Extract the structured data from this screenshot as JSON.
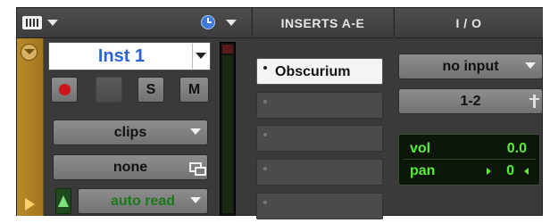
{
  "header": {
    "inserts_title": "INSERTS A-E",
    "io_title": "I / O"
  },
  "track": {
    "name": "Inst 1",
    "solo_label": "S",
    "mute_label": "M",
    "playlist": "clips",
    "group": "none",
    "automation_mode": "auto read"
  },
  "inserts": {
    "slot_a": "Obscurium",
    "slot_b": "",
    "slot_c": "",
    "slot_d": "",
    "slot_e": ""
  },
  "io": {
    "input": "no input",
    "output": "1-2",
    "vol_label": "vol",
    "vol_value": "0.0",
    "pan_label": "pan",
    "pan_value": "0"
  },
  "colors": {
    "track_name_text": "#2a63d8",
    "record_enable": "#c9171d",
    "automation_text": "#1a7a1a",
    "volpan_text": "#55ee33",
    "track_color_strip": "#b88a2e"
  },
  "icons": [
    "track-view-icon",
    "chevron-down-icon",
    "clock-icon",
    "record-icon",
    "output-path-icon",
    "group-icon",
    "automation-icon"
  ]
}
